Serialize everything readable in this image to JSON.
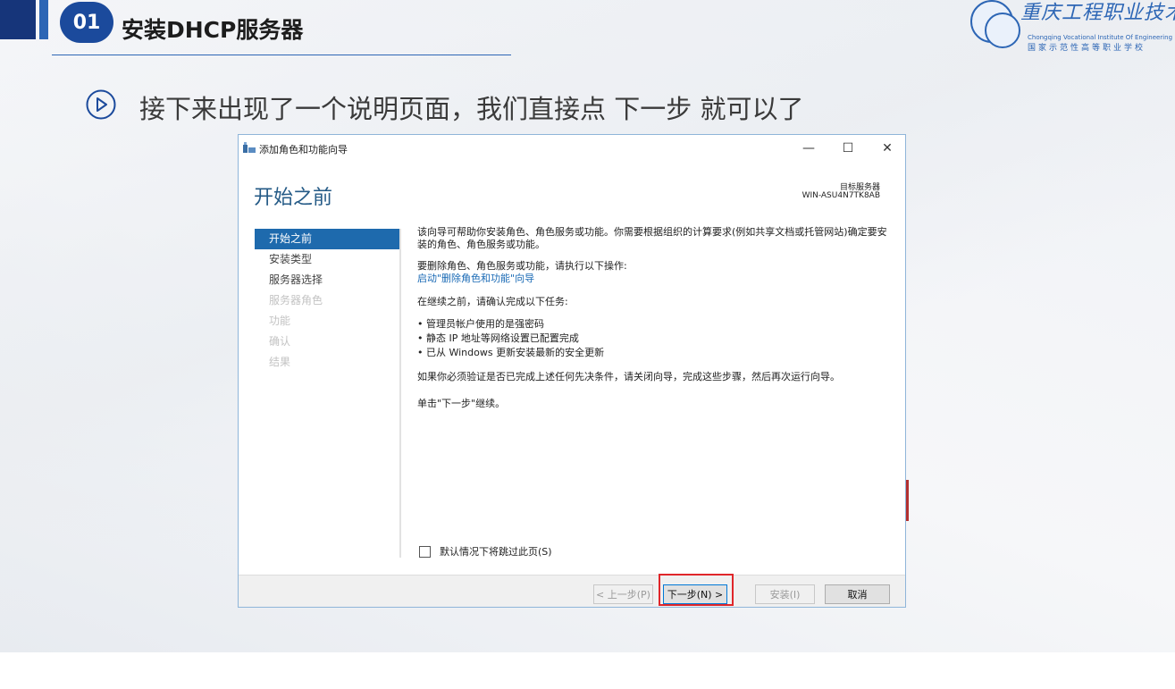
{
  "slide": {
    "section_number": "01",
    "section_title": "安装DHCP服务器",
    "logo": {
      "name_cn": "重庆工程职业技术学院",
      "name_en": "Chongqing Vocational Institute Of Engineering",
      "subtitle_cn": "国家示范性高等职业学校"
    },
    "bullet_text": "接下来出现了一个说明页面，我们直接点 下一步 就可以了"
  },
  "window": {
    "title": "添加角色和功能向导",
    "controls": {
      "minimize": "—",
      "maximize": "☐",
      "close": "✕"
    },
    "page_heading": "开始之前",
    "target_server_label": "目标服务器",
    "target_server_name": "WIN-ASU4N7TK8AB",
    "nav": [
      {
        "label": "开始之前",
        "state": "active"
      },
      {
        "label": "安装类型",
        "state": "enabled"
      },
      {
        "label": "服务器选择",
        "state": "enabled"
      },
      {
        "label": "服务器角色",
        "state": "disabled"
      },
      {
        "label": "功能",
        "state": "disabled"
      },
      {
        "label": "确认",
        "state": "disabled"
      },
      {
        "label": "结果",
        "state": "disabled"
      }
    ],
    "content": {
      "intro": "该向导可帮助你安装角色、角色服务或功能。你需要根据组织的计算要求(例如共享文档或托管网站)确定要安装的角色、角色服务或功能。",
      "remove_text": "要删除角色、角色服务或功能，请执行以下操作:",
      "remove_link": "启动\"删除角色和功能\"向导",
      "confirm_text": "在继续之前，请确认完成以下任务:",
      "tasks": [
        "• 管理员帐户使用的是强密码",
        "• 静态 IP 地址等网络设置已配置完成",
        "• 已从 Windows 更新安装最新的安全更新"
      ],
      "verify_text": "如果你必须验证是否已完成上述任何先决条件，请关闭向导，完成这些步骤，然后再次运行向导。",
      "continue_text": "单击\"下一步\"继续。"
    },
    "skip_checkbox_label": "默认情况下将跳过此页(S)",
    "buttons": {
      "prev": "< 上一步(P)",
      "next": "下一步(N) >",
      "install": "安装(I)",
      "cancel": "取消"
    }
  },
  "colors": {
    "accent_blue": "#1e6aad",
    "heading_blue": "#245a86",
    "highlight_red": "#e0262a",
    "header_navy": "#16357a"
  }
}
